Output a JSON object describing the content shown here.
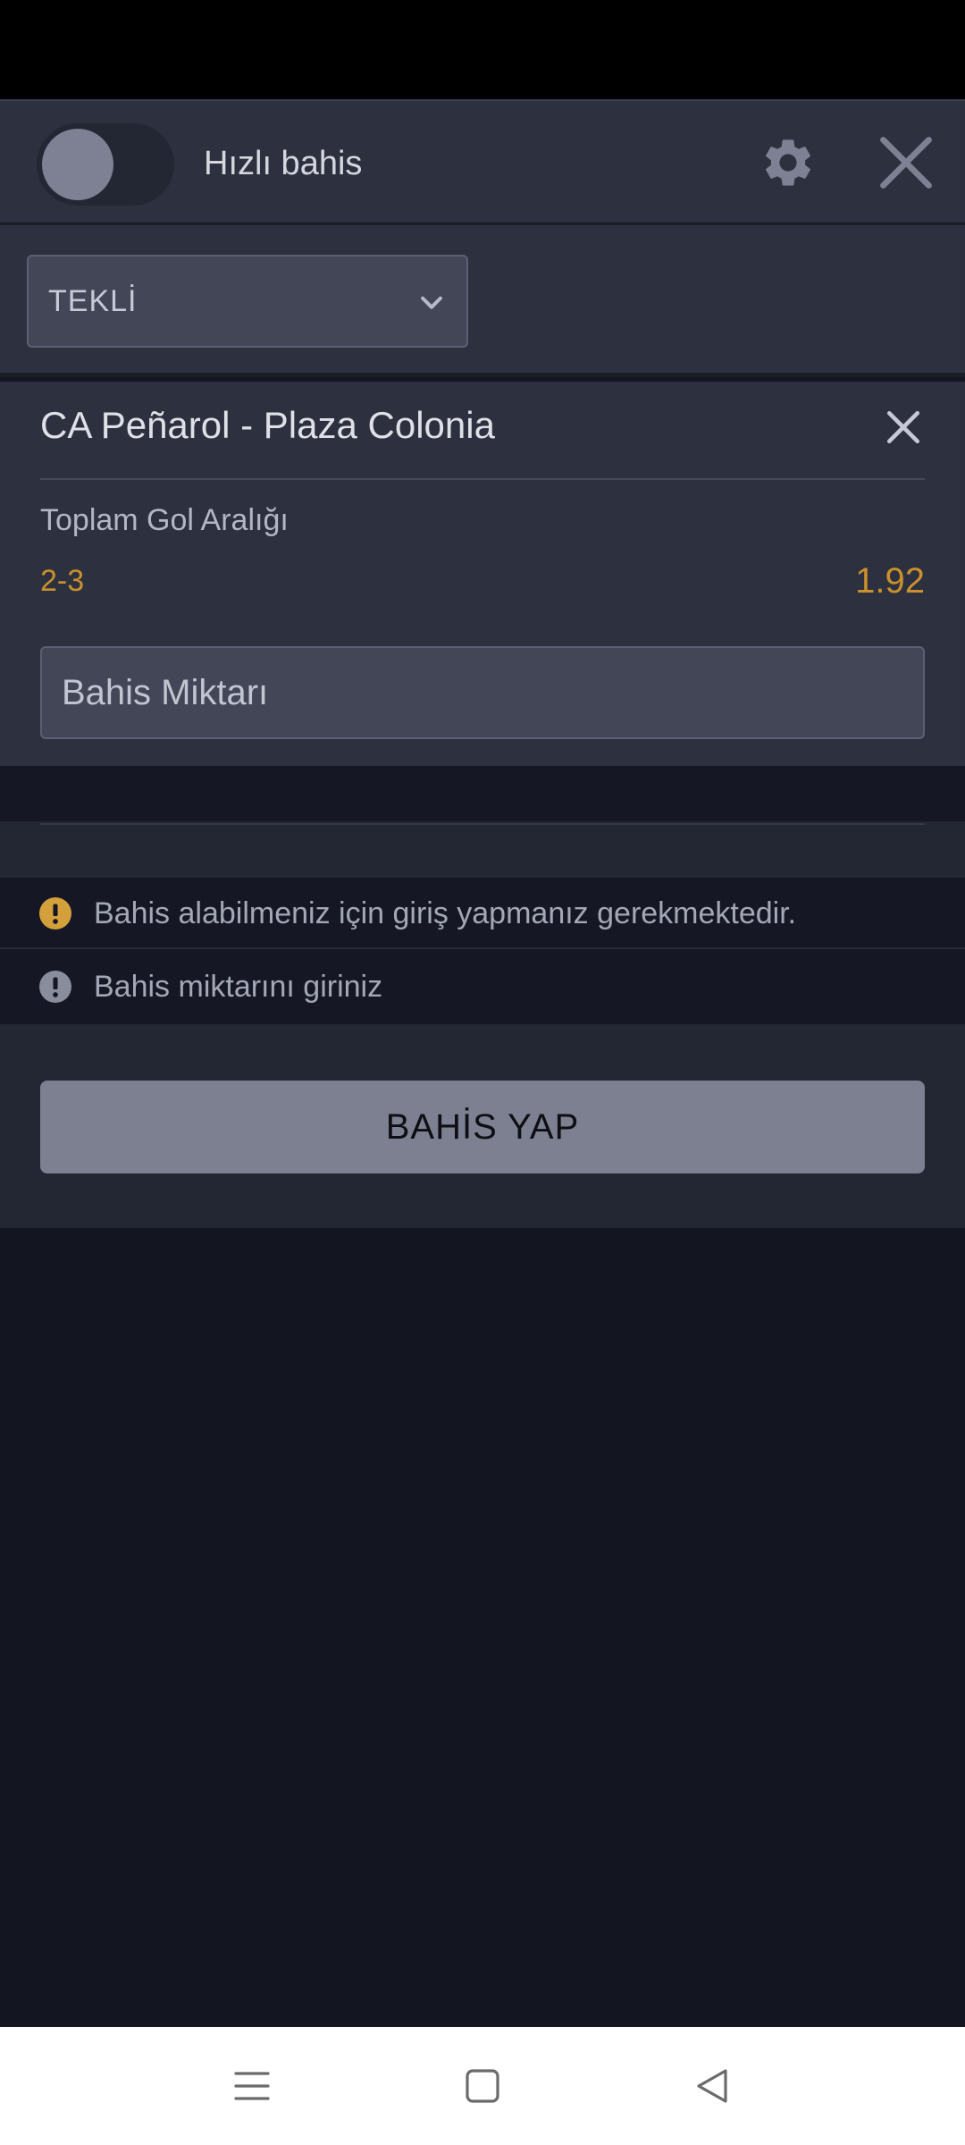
{
  "header": {
    "quick_bet_label": "Hızlı bahis",
    "quick_bet_enabled": false
  },
  "bet_type": {
    "selected": "TEKLİ"
  },
  "bet": {
    "match": "CA Peñarol - Plaza Colonia",
    "market": "Toplam Gol Aralığı",
    "selection": "2-3",
    "odds": "1.92",
    "stake_placeholder": "Bahis Miktarı",
    "stake_value": ""
  },
  "messages": [
    {
      "text": "Bahis alabilmeniz için giriş yapmanız gerekmektedir.",
      "level": "warning",
      "color": "#d4a03b"
    },
    {
      "text": "Bahis miktarını giriniz",
      "level": "info",
      "color": "#8a8e9c"
    }
  ],
  "actions": {
    "place_bet_label": "BAHİS YAP"
  },
  "colors": {
    "accent_odds": "#c8912e",
    "panel": "#2d303e",
    "background": "#131521",
    "button_disabled": "#7c8091"
  },
  "icons": {
    "settings": "gear-icon",
    "close": "close-icon",
    "dropdown": "chevron-down-icon",
    "warning": "exclamation-circle-icon",
    "nav_menu": "menu-icon",
    "nav_home": "square-home-icon",
    "nav_back": "triangle-back-icon"
  }
}
